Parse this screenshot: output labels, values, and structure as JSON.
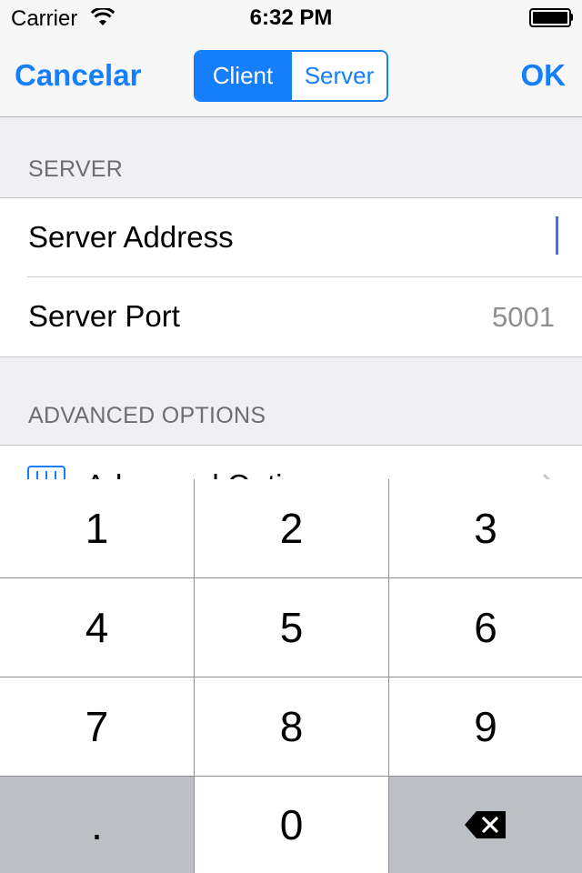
{
  "status_bar": {
    "carrier": "Carrier",
    "time": "6:32 PM"
  },
  "nav": {
    "cancel": "Cancelar",
    "ok": "OK",
    "segments": [
      {
        "label": "Client",
        "selected": true
      },
      {
        "label": "Server",
        "selected": false
      }
    ]
  },
  "server_section": {
    "header": "SERVER",
    "rows": [
      {
        "label": "Server Address",
        "value": ""
      },
      {
        "label": "Server Port",
        "value": "5001"
      }
    ]
  },
  "advanced_section": {
    "header": "ADVANCED OPTIONS",
    "row_label": "Advanced Options"
  },
  "keypad": {
    "keys": [
      "1",
      "2",
      "3",
      "4",
      "5",
      "6",
      "7",
      "8",
      "9",
      ".",
      "0"
    ],
    "delete_icon": "delete-backspace-icon"
  },
  "colors": {
    "tint": "#157efb",
    "keypad_dark_key": "#bcbfc4",
    "section_text": "#6d6d72"
  }
}
